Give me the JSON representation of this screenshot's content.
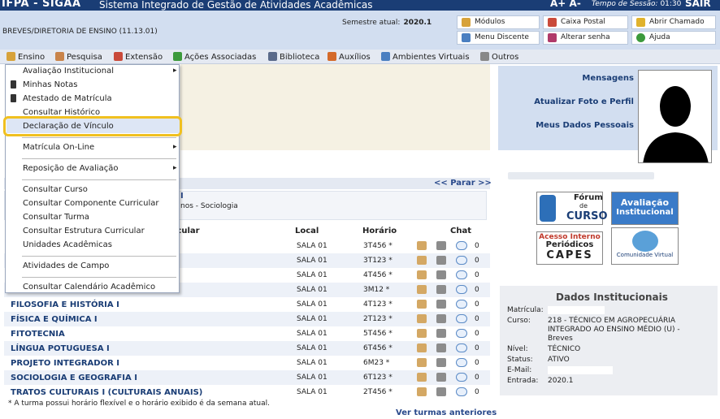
{
  "topbar": {
    "brand": "IFPA - SIGAA",
    "system": "Sistema Integrado de Gestão de Atividades Acadêmicas",
    "font_plus": "A+",
    "font_minus": "A-",
    "session_label": "Tempo de Sessão:",
    "session_time": "01:30",
    "logout": "SAIR"
  },
  "infobar": {
    "unit": "BREVES/DIRETORIA DE ENSINO (11.13.01)",
    "semester_label": "Semestre atual:",
    "semester_value": "2020.1"
  },
  "quick": {
    "modulos": "Módulos",
    "caixa": "Caixa Postal",
    "chamado": "Abrir Chamado",
    "menu_discente": "Menu Discente",
    "senha": "Alterar senha",
    "ajuda": "Ajuda"
  },
  "menu": [
    "Ensino",
    "Pesquisa",
    "Extensão",
    "Ações Associadas",
    "Biblioteca",
    "Auxílios",
    "Ambientes Virtuais",
    "Outros"
  ],
  "dropdown": {
    "items": [
      "Avaliação Institucional",
      "Minhas Notas",
      "Atestado de Matrícula",
      "Consultar Histórico",
      "Declaração de Vínculo",
      "Matrícula On-Line",
      "Reposição de Avaliação",
      "Consultar Curso",
      "Consultar Componente Curricular",
      "Consultar Turma",
      "Consultar Estrutura Curricular",
      "Unidades Acadêmicas",
      "Atividades de Campo",
      "Consultar Calendário Acadêmico"
    ]
  },
  "turmas": {
    "parar": "<< Parar >>",
    "partial_title": "I",
    "partial_sub": "nos - Sociologia",
    "headers": {
      "componente": "icular",
      "local": "Local",
      "horario": "Horário",
      "chat": "Chat"
    },
    "rows": [
      {
        "name": "",
        "local": "SALA 01",
        "horario": "3T456 *",
        "chat": "0"
      },
      {
        "name": "",
        "local": "SALA 01",
        "horario": "3T123 *",
        "chat": "0"
      },
      {
        "name": "",
        "local": "SALA 01",
        "horario": "4T456 *",
        "chat": "0"
      },
      {
        "name": "",
        "local": "SALA 01",
        "horario": "3M12 *",
        "chat": "0"
      },
      {
        "name": "FILOSOFIA E HISTÓRIA I",
        "local": "SALA 01",
        "horario": "4T123 *",
        "chat": "0"
      },
      {
        "name": "FÍSICA E QUÍMICA I",
        "local": "SALA 01",
        "horario": "2T123 *",
        "chat": "0"
      },
      {
        "name": "FITOTECNIA",
        "local": "SALA 01",
        "horario": "5T456 *",
        "chat": "0"
      },
      {
        "name": "LÍNGUA POTUGUESA I",
        "local": "SALA 01",
        "horario": "6T456 *",
        "chat": "0"
      },
      {
        "name": "PROJETO INTEGRADOR I",
        "local": "SALA 01",
        "horario": "6M23 *",
        "chat": "0"
      },
      {
        "name": "SOCIOLOGIA E GEOGRAFIA I",
        "local": "SALA 01",
        "horario": "6T123 *",
        "chat": "0"
      },
      {
        "name": "TRATOS CULTURAIS I (CULTURAIS ANUAIS)",
        "local": "SALA 01",
        "horario": "2T456 *",
        "chat": "0"
      }
    ],
    "footnote": "* A turma possui horário flexível e o horário exibido é da semana atual.",
    "anteriores": "Ver turmas anteriores"
  },
  "profile": {
    "mensagens": "Mensagens",
    "foto": "Atualizar Foto e Perfil",
    "dados": "Meus Dados Pessoais"
  },
  "links": {
    "forum_line1": "Fórum",
    "forum_line2": "de",
    "forum_line3": "CURSO",
    "aval_line1": "Avaliação",
    "aval_line2": "Institucional",
    "capes_line1": "Acesso Interno",
    "capes_line2": "Periódicos",
    "capes_line3": "CAPES",
    "comunidade": "Comunidade Virtual"
  },
  "dados": {
    "title": "Dados Institucionais",
    "matricula_label": "Matrícula:",
    "curso_label": "Curso:",
    "nivel_label": "Nível:",
    "status_label": "Status:",
    "email_label": "E-Mail:",
    "entrada_label": "Entrada:",
    "curso_line1": "218 - TÉCNICO EM AGROPECUÁRIA",
    "curso_line2": "INTEGRADO AO ENSINO MÉDIO (U) -",
    "curso_line3": "Breves",
    "nivel": "TÉCNICO",
    "status": "ATIVO",
    "entrada": "2020.1"
  },
  "colors": {
    "topbar": "#1a3d75",
    "infobar": "#d2def0",
    "link": "#1a3d75",
    "highlight": "#f0c020"
  }
}
